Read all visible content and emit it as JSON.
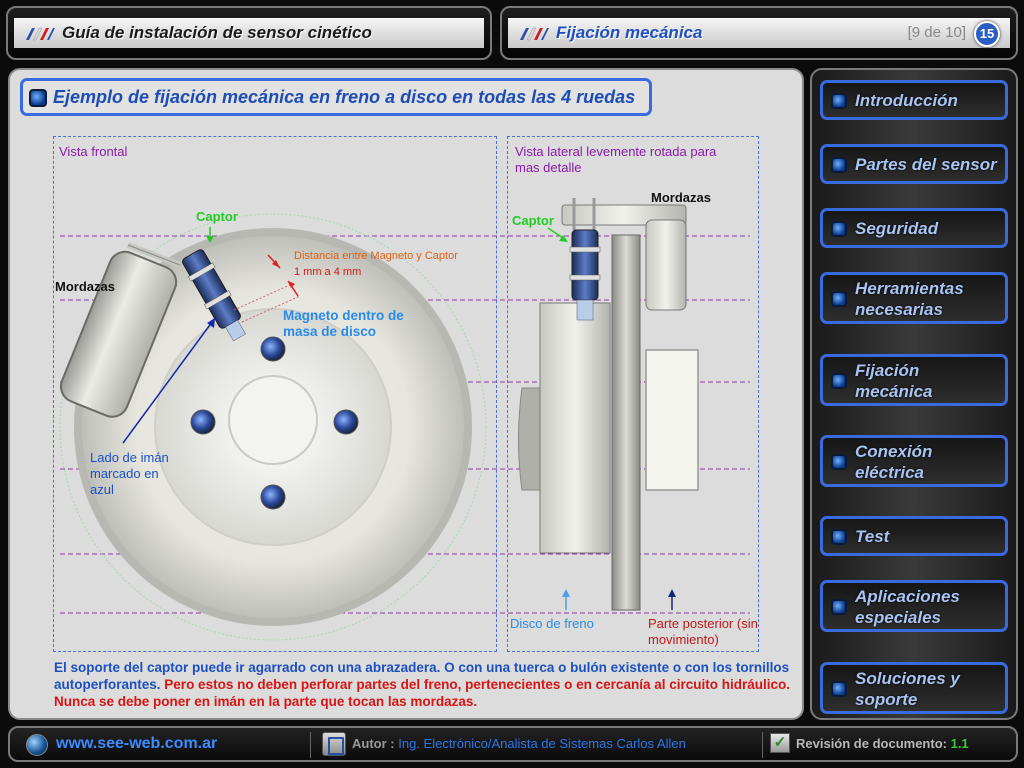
{
  "header_left": {
    "title": "Guía de instalación de sensor cinético"
  },
  "header_right": {
    "title": "Fijación mecánica",
    "page_count": "[9 de 10]",
    "page_number": "15"
  },
  "slide": {
    "title": "Ejemplo de fijación mecánica en freno a disco en todas las 4 ruedas",
    "front_view": {
      "label": "Vista frontal",
      "captor": "Captor",
      "mordazas": "Mordazas",
      "distance_label": "Distancia entre Magneto y Captor",
      "distance_value": "1 mm a 4 mm",
      "magnet_label": "Magneto dentro de masa de disco",
      "magnet_side_label": "Lado de imán marcado en azul"
    },
    "side_view": {
      "label": "Vista lateral levemente rotada para mas detalle",
      "mordazas": "Mordazas",
      "captor": "Captor",
      "disc_label": "Disco de freno",
      "rear_label": "Parte posterior (sin movimiento)"
    },
    "caption": {
      "part1": "El soporte del captor puede ir agarrado con una abrazadera. O con una tuerca o bulón existente o con los tornillos autoperforantes.",
      "part2": "Pero estos no deben perforar partes del freno, pertenecientes o en cercanía al circuito hidráulico. Nunca se debe poner en imán en la parte que tocan las mordazas."
    }
  },
  "sidebar": {
    "items": [
      {
        "label": "Introducción"
      },
      {
        "label": "Partes del sensor"
      },
      {
        "label": "Seguridad"
      },
      {
        "label": "Herramientas necesarias"
      },
      {
        "label": "Fijación mecánica"
      },
      {
        "label": "Conexión eléctrica"
      },
      {
        "label": "Test"
      },
      {
        "label": "Aplicaciones especiales"
      },
      {
        "label": "Soluciones y soporte"
      }
    ]
  },
  "footer": {
    "website": "www.see-web.com.ar",
    "author_label": "Autor :",
    "author_value": "Ing. Electrónico/Analista de Sistemas Carlos Allen",
    "revision_label": "Revisión de documento:",
    "revision_value": "1.1"
  },
  "colors": {
    "accent": "#3a6ae0",
    "caption_blue": "#1c50c0",
    "caption_red": "#d81414",
    "captor_green": "#22cc22",
    "magnet_blue": "#2a8ae8"
  }
}
